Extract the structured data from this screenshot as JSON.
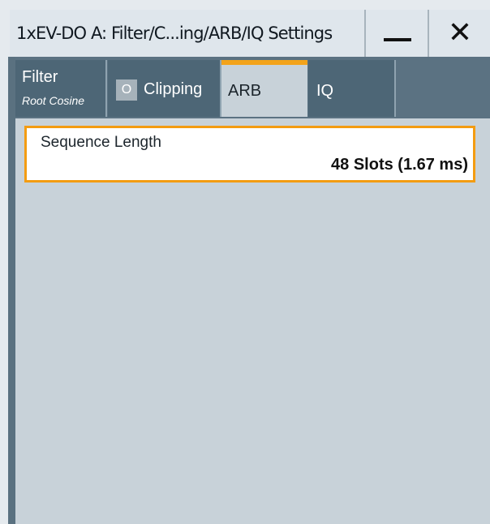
{
  "window": {
    "title": "1xEV-DO A: Filter/C...ing/ARB/IQ Settings",
    "minimize_icon": "minimize-icon",
    "close_icon": "close-icon",
    "close_glyph": "✕"
  },
  "tabs": [
    {
      "label": "Filter",
      "sublabel": "Root Cosine",
      "selected": false
    },
    {
      "label": "Clipping",
      "indicator": "O",
      "selected": false
    },
    {
      "label": "ARB",
      "selected": true
    },
    {
      "label": "IQ",
      "selected": false
    }
  ],
  "arb": {
    "sequence_length_label": "Sequence Length",
    "sequence_length_value": "48  Slots (1.67 ms)"
  },
  "colors": {
    "accent": "#f2a31b",
    "tab_active_bg": "#c8d2d9",
    "tab_inactive_bg": "#4d6676"
  }
}
